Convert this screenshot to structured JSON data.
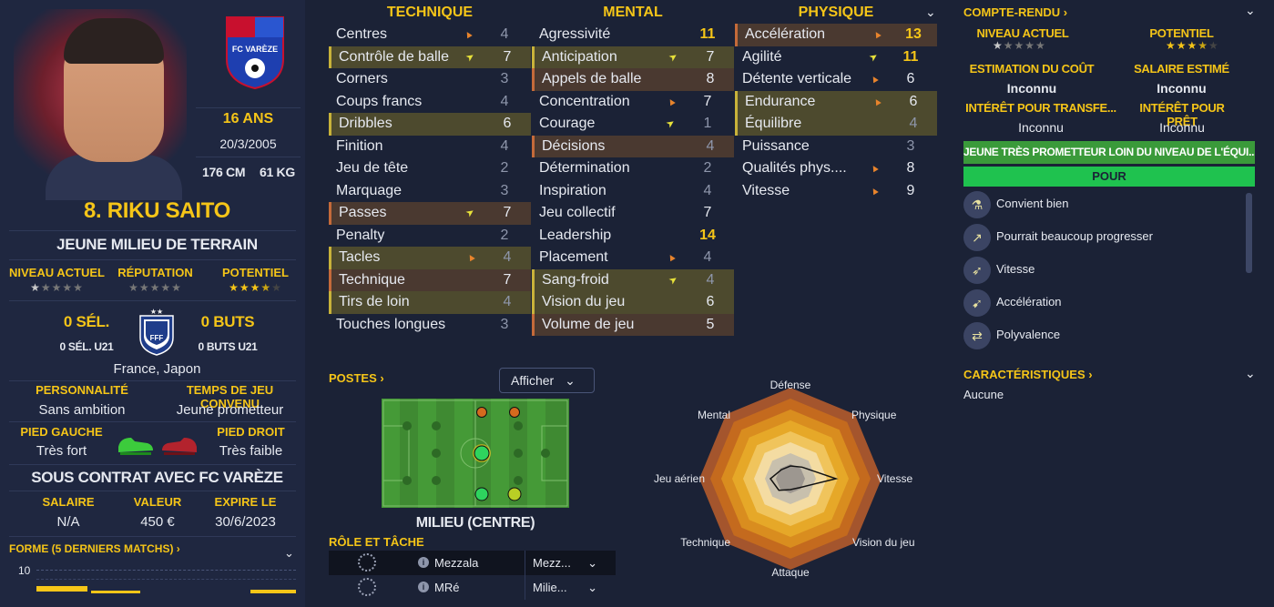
{
  "player": {
    "name": "8. RIKU SAITO",
    "age": "16 ANS",
    "birth": "20/3/2005",
    "height": "176 CM",
    "weight": "61 KG",
    "role": "JEUNE MILIEU DE TERRAIN",
    "club_crest_text": "FC VARÈZE",
    "labels": {
      "niveau": "NIVEAU ACTUEL",
      "reputation": "RÉPUTATION",
      "potentiel": "POTENTIEL"
    },
    "niveau_stars": 1.5,
    "reputation_stars": 0,
    "potentiel_stars": 3.5,
    "sel": "0 SÉL.",
    "sel_u21": "0 SÉL. U21",
    "buts": "0 BUTS",
    "buts_u21": "0 BUTS U21",
    "federation": "FFF",
    "nationality": "France, Japon",
    "personnalite_label": "PERSONNALITÉ",
    "personnalite": "Sans ambition",
    "temps_label": "TEMPS DE JEU CONVENU",
    "temps": "Jeune prometteur",
    "pied_gauche_label": "PIED GAUCHE",
    "pied_gauche": "Très fort",
    "pied_droit_label": "PIED DROIT",
    "pied_droit": "Très faible",
    "contract": "SOUS CONTRAT AVEC FC VARÈZE",
    "salaire_label": "SALAIRE",
    "salaire": "N/A",
    "valeur_label": "VALEUR",
    "valeur": "450 €",
    "expire_label": "EXPIRE LE",
    "expire": "30/6/2023",
    "forme_label": "FORME (5 DERNIERS MATCHS) ›",
    "forme_axis": "10"
  },
  "technique": {
    "title": "TECHNIQUE",
    "rows": [
      {
        "name": "Centres",
        "value": "4",
        "arrow": "up",
        "hl": ""
      },
      {
        "name": "Contrôle de balle",
        "value": "7",
        "arrow": "right",
        "hl": "y"
      },
      {
        "name": "Corners",
        "value": "3",
        "arrow": "",
        "hl": ""
      },
      {
        "name": "Coups francs",
        "value": "4",
        "arrow": "",
        "hl": ""
      },
      {
        "name": "Dribbles",
        "value": "6",
        "arrow": "",
        "hl": "y"
      },
      {
        "name": "Finition",
        "value": "4",
        "arrow": "",
        "hl": ""
      },
      {
        "name": "Jeu de tête",
        "value": "2",
        "arrow": "",
        "hl": ""
      },
      {
        "name": "Marquage",
        "value": "3",
        "arrow": "",
        "hl": ""
      },
      {
        "name": "Passes",
        "value": "7",
        "arrow": "right",
        "hl": "o"
      },
      {
        "name": "Penalty",
        "value": "2",
        "arrow": "",
        "hl": ""
      },
      {
        "name": "Tacles",
        "value": "4",
        "arrow": "up",
        "hl": "y"
      },
      {
        "name": "Technique",
        "value": "7",
        "arrow": "",
        "hl": "o"
      },
      {
        "name": "Tirs de loin",
        "value": "4",
        "arrow": "",
        "hl": "y"
      },
      {
        "name": "Touches longues",
        "value": "3",
        "arrow": "",
        "hl": ""
      }
    ]
  },
  "mental": {
    "title": "MENTAL",
    "rows": [
      {
        "name": "Agressivité",
        "value": "11",
        "arrow": "",
        "hl": ""
      },
      {
        "name": "Anticipation",
        "value": "7",
        "arrow": "right",
        "hl": "y"
      },
      {
        "name": "Appels de balle",
        "value": "8",
        "arrow": "",
        "hl": "o"
      },
      {
        "name": "Concentration",
        "value": "7",
        "arrow": "up",
        "hl": ""
      },
      {
        "name": "Courage",
        "value": "1",
        "arrow": "right",
        "hl": ""
      },
      {
        "name": "Décisions",
        "value": "4",
        "arrow": "",
        "hl": "o"
      },
      {
        "name": "Détermination",
        "value": "2",
        "arrow": "",
        "hl": ""
      },
      {
        "name": "Inspiration",
        "value": "4",
        "arrow": "",
        "hl": ""
      },
      {
        "name": "Jeu collectif",
        "value": "7",
        "arrow": "",
        "hl": ""
      },
      {
        "name": "Leadership",
        "value": "14",
        "arrow": "",
        "hl": ""
      },
      {
        "name": "Placement",
        "value": "4",
        "arrow": "up",
        "hl": ""
      },
      {
        "name": "Sang-froid",
        "value": "4",
        "arrow": "right",
        "hl": "y"
      },
      {
        "name": "Vision du jeu",
        "value": "6",
        "arrow": "",
        "hl": "y"
      },
      {
        "name": "Volume de jeu",
        "value": "5",
        "arrow": "",
        "hl": "o"
      }
    ]
  },
  "physique": {
    "title": "PHYSIQUE",
    "rows": [
      {
        "name": "Accélération",
        "value": "13",
        "arrow": "up",
        "hl": "o"
      },
      {
        "name": "Agilité",
        "value": "11",
        "arrow": "right",
        "hl": ""
      },
      {
        "name": "Détente verticale",
        "value": "6",
        "arrow": "up",
        "hl": ""
      },
      {
        "name": "Endurance",
        "value": "6",
        "arrow": "up",
        "hl": "y"
      },
      {
        "name": "Équilibre",
        "value": "4",
        "arrow": "",
        "hl": "y"
      },
      {
        "name": "Puissance",
        "value": "3",
        "arrow": "",
        "hl": ""
      },
      {
        "name": "Qualités phys....",
        "value": "8",
        "arrow": "up",
        "hl": ""
      },
      {
        "name": "Vitesse",
        "value": "9",
        "arrow": "up",
        "hl": ""
      }
    ]
  },
  "postes": {
    "label": "POSTES ›",
    "afficher": "Afficher",
    "position": "MILIEU (CENTRE)",
    "role_label": "RÔLE ET TÂCHE",
    "roles": [
      {
        "name": "Mezzala",
        "select": "Mezz..."
      },
      {
        "name": "MRé",
        "select": "Milie..."
      }
    ]
  },
  "radar": {
    "labels": [
      "Défense",
      "Physique",
      "Vitesse",
      "Vision du jeu",
      "Attaque",
      "Technique",
      "Jeu aérien",
      "Mental"
    ]
  },
  "report": {
    "title": "COMPTE-RENDU ›",
    "niveau_label": "NIVEAU ACTUEL",
    "potentiel_label": "POTENTIEL",
    "niveau_stars": 1.5,
    "potentiel_stars": 3.5,
    "cout_label": "ESTIMATION DU COÛT",
    "cout": "Inconnu",
    "salaire_label": "SALAIRE ESTIMÉ",
    "salaire": "Inconnu",
    "transfert_label": "INTÉRÊT POUR TRANSFE...",
    "transfert": "Inconnu",
    "pret_label": "INTÉRÊT POUR PRÊT",
    "pret": "Inconnu",
    "banner": "JEUNE TRÈS PROMETTEUR LOIN DU NIVEAU DE L'ÉQUI...",
    "pour": "POUR",
    "items": [
      {
        "icon": "flask-icon",
        "glyph": "⚗",
        "text": "Convient bien"
      },
      {
        "icon": "trend-up-icon",
        "glyph": "↗",
        "text": "Pourrait beaucoup progresser"
      },
      {
        "icon": "speed-icon",
        "glyph": "➶",
        "text": "Vitesse"
      },
      {
        "icon": "acceleration-icon",
        "glyph": "➹",
        "text": "Accélération"
      },
      {
        "icon": "versatility-icon",
        "glyph": "⇄",
        "text": "Polyvalence"
      }
    ],
    "carac_label": "CARACTÉRISTIQUES ›",
    "carac": "Aucune"
  }
}
